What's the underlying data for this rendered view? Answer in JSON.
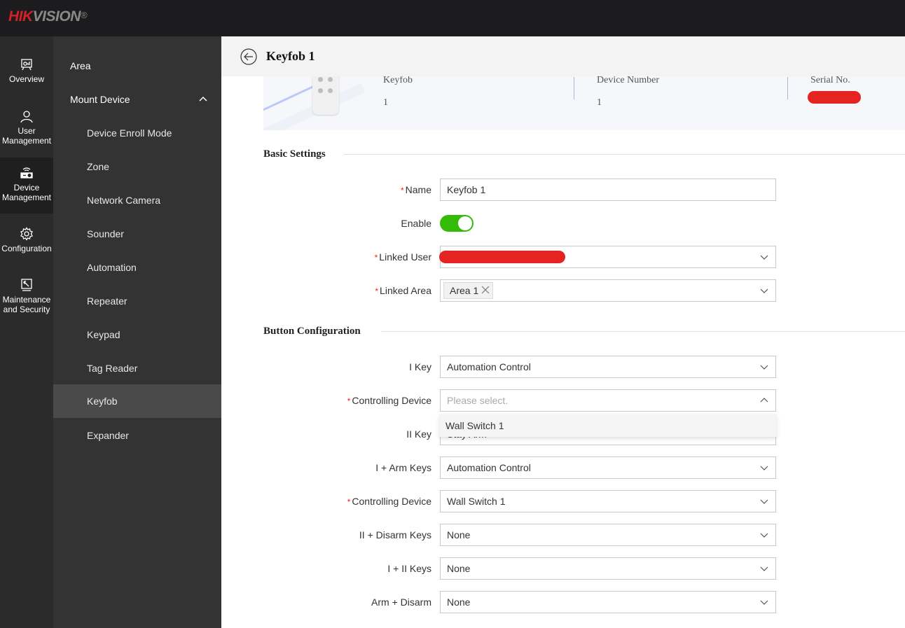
{
  "brand": {
    "hik": "HIK",
    "vision": "VISION",
    "reg": "®"
  },
  "rail": [
    {
      "label_1": "Overview",
      "label_2": "",
      "icon": "overview-icon"
    },
    {
      "label_1": "User",
      "label_2": "Management",
      "icon": "user-icon"
    },
    {
      "label_1": "Device",
      "label_2": "Management",
      "icon": "device-icon",
      "active": true
    },
    {
      "label_1": "Configuration",
      "label_2": "",
      "icon": "gear-icon"
    },
    {
      "label_1": "Maintenance",
      "label_2": "and Security",
      "icon": "maintenance-icon"
    }
  ],
  "submenu": {
    "area": "Area",
    "mount_device": "Mount Device",
    "items": [
      "Device Enroll Mode",
      "Zone",
      "Network Camera",
      "Sounder",
      "Automation",
      "Repeater",
      "Keypad",
      "Tag Reader",
      "Keyfob",
      "Expander"
    ],
    "active": "Keyfob"
  },
  "header": {
    "title": "Keyfob 1"
  },
  "device_card": {
    "type_label": "Keyfob",
    "type_value": "1",
    "number_label": "Device Number",
    "number_value": "1",
    "serial_label": "Serial No.",
    "serial_value": "[redacted]"
  },
  "basic": {
    "title": "Basic Settings",
    "name_label": "Name",
    "name_value": "Keyfob 1",
    "enable_label": "Enable",
    "enable_value": true,
    "linked_user_label": "Linked User",
    "linked_user_value": "[redacted]",
    "linked_area_label": "Linked Area",
    "linked_area_tags": [
      "Area 1"
    ]
  },
  "buttons": {
    "title": "Button Configuration",
    "rows": [
      {
        "label": "I Key",
        "required": false,
        "value": "Automation Control",
        "placeholder": ""
      },
      {
        "label": "Controlling Device",
        "required": true,
        "value": "",
        "placeholder": "Please select.",
        "open": true
      },
      {
        "label": "II Key",
        "required": false,
        "value": "Stay Arm",
        "placeholder": ""
      },
      {
        "label": "I + Arm Keys",
        "required": false,
        "value": "Automation Control",
        "placeholder": ""
      },
      {
        "label": "Controlling Device",
        "required": true,
        "value": "Wall Switch 1",
        "placeholder": ""
      },
      {
        "label": "II + Disarm Keys",
        "required": false,
        "value": "None",
        "placeholder": ""
      },
      {
        "label": "I + II Keys",
        "required": false,
        "value": "None",
        "placeholder": ""
      },
      {
        "label": "Arm + Disarm",
        "required": false,
        "value": "None",
        "placeholder": ""
      }
    ],
    "dropdown_options": [
      "Wall Switch 1"
    ]
  },
  "colors": {
    "accent_toggle": "#34bb08",
    "required": "#e52421",
    "brand_red": "#d22128"
  }
}
